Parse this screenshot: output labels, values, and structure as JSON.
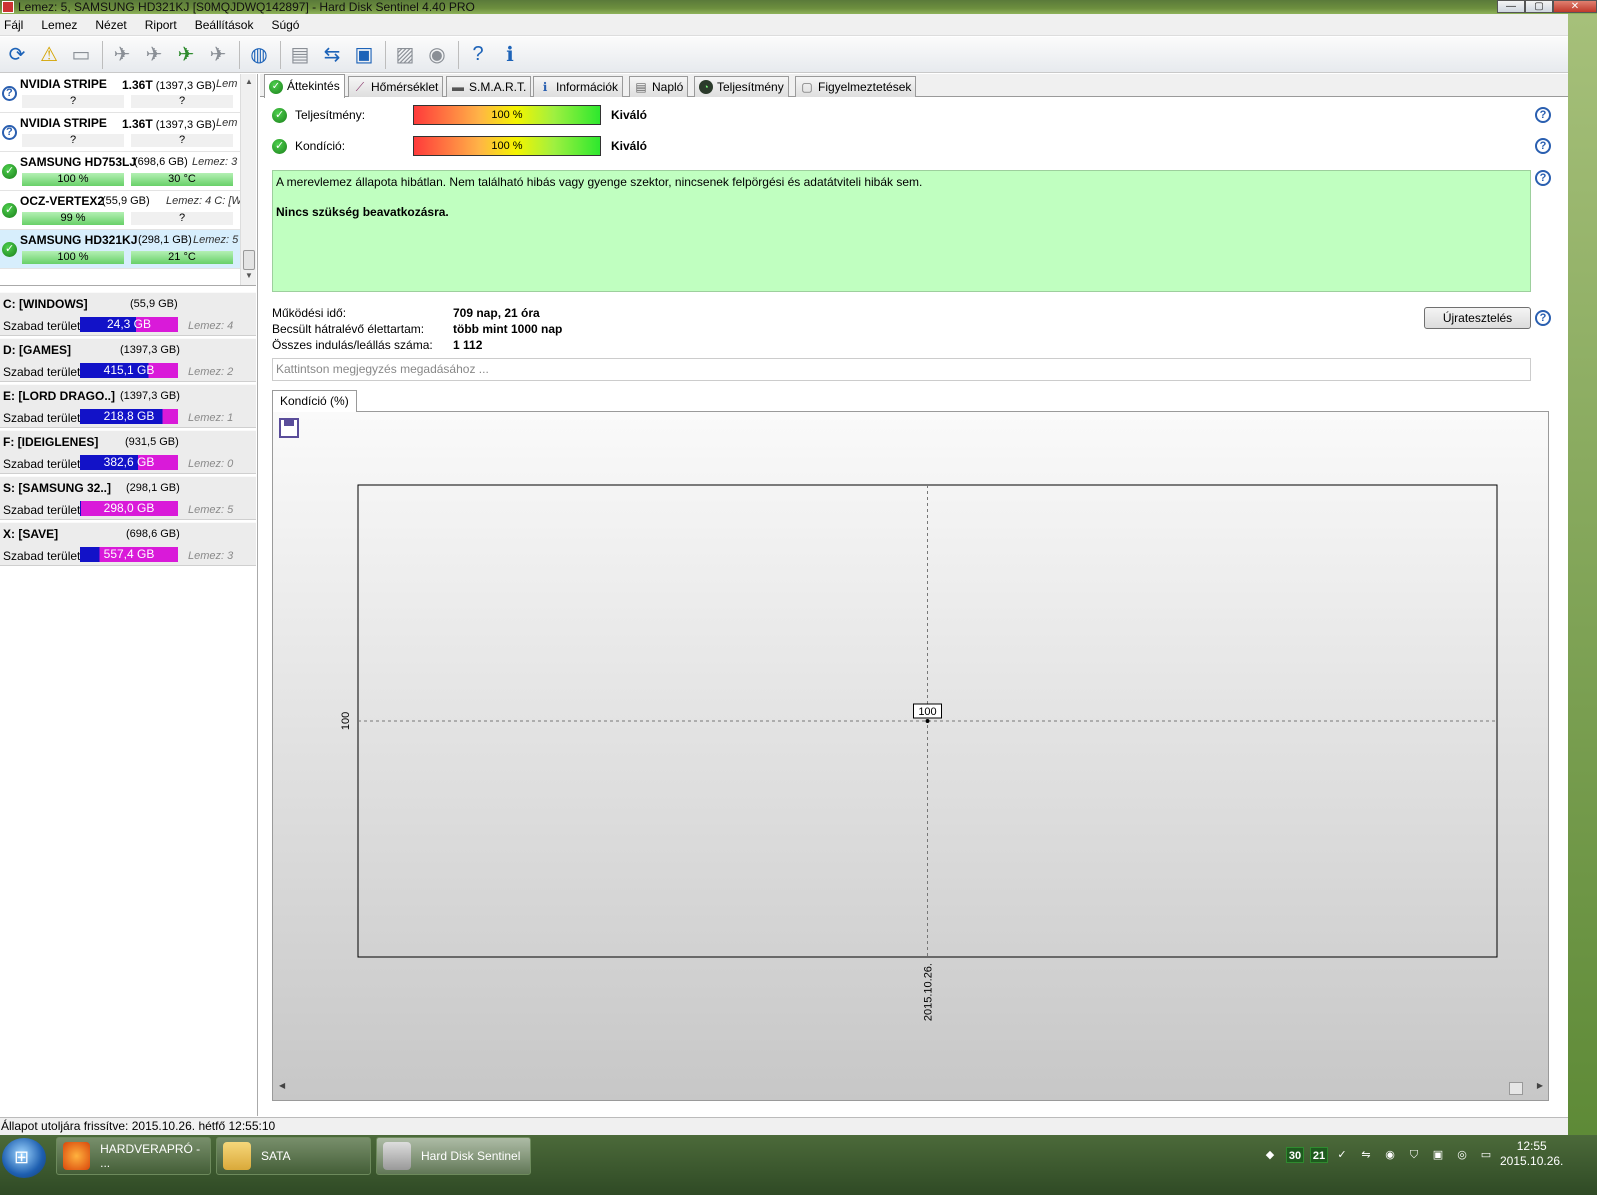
{
  "window": {
    "title": "Lemez: 5, SAMSUNG HD321KJ [S0MQJDWQ142897]  -  Hard Disk Sentinel 4.40 PRO",
    "minimize": "—",
    "maximize": "▢",
    "close": "✕"
  },
  "menu": [
    "Fájl",
    "Lemez",
    "Nézet",
    "Riport",
    "Beállítások",
    "Súgó"
  ],
  "disks": [
    {
      "name": "NVIDIA  STRIPE",
      "size_t": "1.36T",
      "size_gb": "(1397,3 GB)",
      "extra": "Lem",
      "status": "unknown",
      "health": "?",
      "temp": "?"
    },
    {
      "name": "NVIDIA  STRIPE",
      "size_t": "1.36T",
      "size_gb": "(1397,3 GB)",
      "extra": "Lem",
      "status": "unknown",
      "health": "?",
      "temp": "?"
    },
    {
      "name": "SAMSUNG HD753LJ",
      "size_t": "",
      "size_gb": "(698,6 GB)",
      "extra": "Lemez: 3",
      "status": "ok",
      "health": "100 %",
      "temp": "30 °C"
    },
    {
      "name": "OCZ-VERTEX2",
      "size_t": "",
      "size_gb": "(55,9 GB)",
      "extra": "Lemez: 4   C: [WI",
      "status": "ok",
      "health": "99 %",
      "temp": "?"
    },
    {
      "name": "SAMSUNG HD321KJ",
      "size_t": "",
      "size_gb": "(298,1 GB)",
      "extra": "Lemez: 5",
      "status": "ok",
      "health": "100 %",
      "temp": "21 °C"
    }
  ],
  "volumes": [
    {
      "name": "C: [WINDOWS]",
      "size": "(55,9 GB)",
      "free_label": "Szabad terület",
      "free": "24,3 GB",
      "free_pct": 43,
      "disk": "Lemez: 4"
    },
    {
      "name": "D: [GAMES]",
      "size": "(1397,3 GB)",
      "free_label": "Szabad terület",
      "free": "415,1 GB",
      "free_pct": 30,
      "disk": "Lemez: 2"
    },
    {
      "name": "E: [LORD DRAGO..]",
      "size": "(1397,3 GB)",
      "free_label": "Szabad terület",
      "free": "218,8 GB",
      "free_pct": 16,
      "disk": "Lemez: 1"
    },
    {
      "name": "F: [IDEIGLENES]",
      "size": "(931,5 GB)",
      "free_label": "Szabad terület",
      "free": "382,6 GB",
      "free_pct": 41,
      "disk": "Lemez: 0"
    },
    {
      "name": "S: [SAMSUNG 32..]",
      "size": "(298,1 GB)",
      "free_label": "Szabad terület",
      "free": "298,0 GB",
      "free_pct": 99,
      "disk": "Lemez: 5"
    },
    {
      "name": "X: [SAVE]",
      "size": "(698,6 GB)",
      "free_label": "Szabad terület",
      "free": "557,4 GB",
      "free_pct": 80,
      "disk": "Lemez: 3"
    }
  ],
  "tabs": [
    "Áttekintés",
    "Hőmérséklet",
    "S.M.A.R.T.",
    "Információk",
    "Napló",
    "Teljesítmény",
    "Figyelmeztetések"
  ],
  "overview": {
    "performance_label": "Teljesítmény:",
    "performance_value": "100 %",
    "performance_pct": 100,
    "performance_result": "Kiváló",
    "condition_label": "Kondíció:",
    "condition_value": "100 %",
    "condition_pct": 100,
    "condition_result": "Kiváló",
    "message_line1": "A merevlemez állapota hibátlan. Nem található hibás vagy gyenge szektor, nincsenek felpörgési és adatátviteli hibák sem.",
    "message_line2": "Nincs szükség beavatkozásra.",
    "uptime_label": "Működési idő:",
    "uptime_value": "709 nap, 21 óra",
    "lifetime_label": "Becsült hátralévő élettartam:",
    "lifetime_value": "több mint 1000 nap",
    "starts_label": "Összes indulás/leállás száma:",
    "starts_value": "1 112",
    "retest_button": "Újratesztelés",
    "note_placeholder": "Kattintson megjegyzés megadásához ..."
  },
  "chart_tab": "Kondíció  (%)",
  "chart_data": {
    "type": "line",
    "x": [
      "2015.10.26."
    ],
    "series": [
      {
        "values": [
          100
        ]
      }
    ],
    "point_labels": [
      "100"
    ],
    "y_tick_labels": [
      "100"
    ],
    "x_tick_labels": [
      "2015.10.26."
    ],
    "grid": true
  },
  "statusbar": "Állapot utoljára frissítve: 2015.10.26. hétfő 12:55:10",
  "taskbar": {
    "tasks": [
      "HARDVERAPRÓ - ...",
      "SATA",
      "Hard Disk Sentinel"
    ],
    "tray_num1": "30",
    "tray_num2": "21",
    "time": "12:55",
    "date": "2015.10.26."
  }
}
